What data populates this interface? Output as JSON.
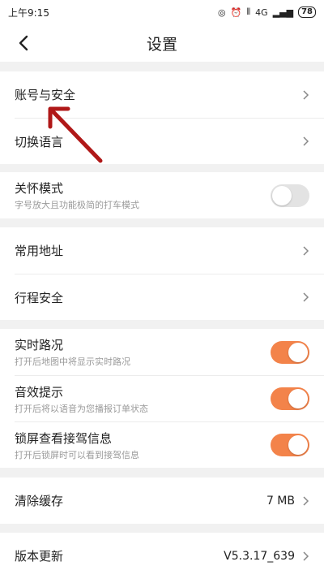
{
  "status_bar": {
    "time": "上午9:15",
    "network": "4G",
    "battery": "78"
  },
  "header": {
    "title": "设置"
  },
  "rows": {
    "account": "账号与安全",
    "language": "切换语言",
    "care_mode": {
      "label": "关怀模式",
      "sub": "字号放大且功能极简的打车模式",
      "on": false
    },
    "address": "常用地址",
    "trip_safety": "行程安全",
    "traffic": {
      "label": "实时路况",
      "sub": "打开后地图中将显示实时路况",
      "on": true
    },
    "sound": {
      "label": "音效提示",
      "sub": "打开后将以语音为您播报订单状态",
      "on": true
    },
    "lockscreen": {
      "label": "锁屏查看接驾信息",
      "sub": "打开后锁屏时可以看到接驾信息",
      "on": true
    },
    "cache": {
      "label": "清除缓存",
      "value": "7 MB"
    },
    "version": {
      "label": "版本更新",
      "value": "V5.3.17_639"
    }
  },
  "colors": {
    "accent": "#f3834a",
    "annotation_arrow": "#b01818"
  },
  "icons": [
    "back-arrow-icon",
    "chevron-right-icon",
    "alarm-icon",
    "signal-icon",
    "battery-icon"
  ]
}
